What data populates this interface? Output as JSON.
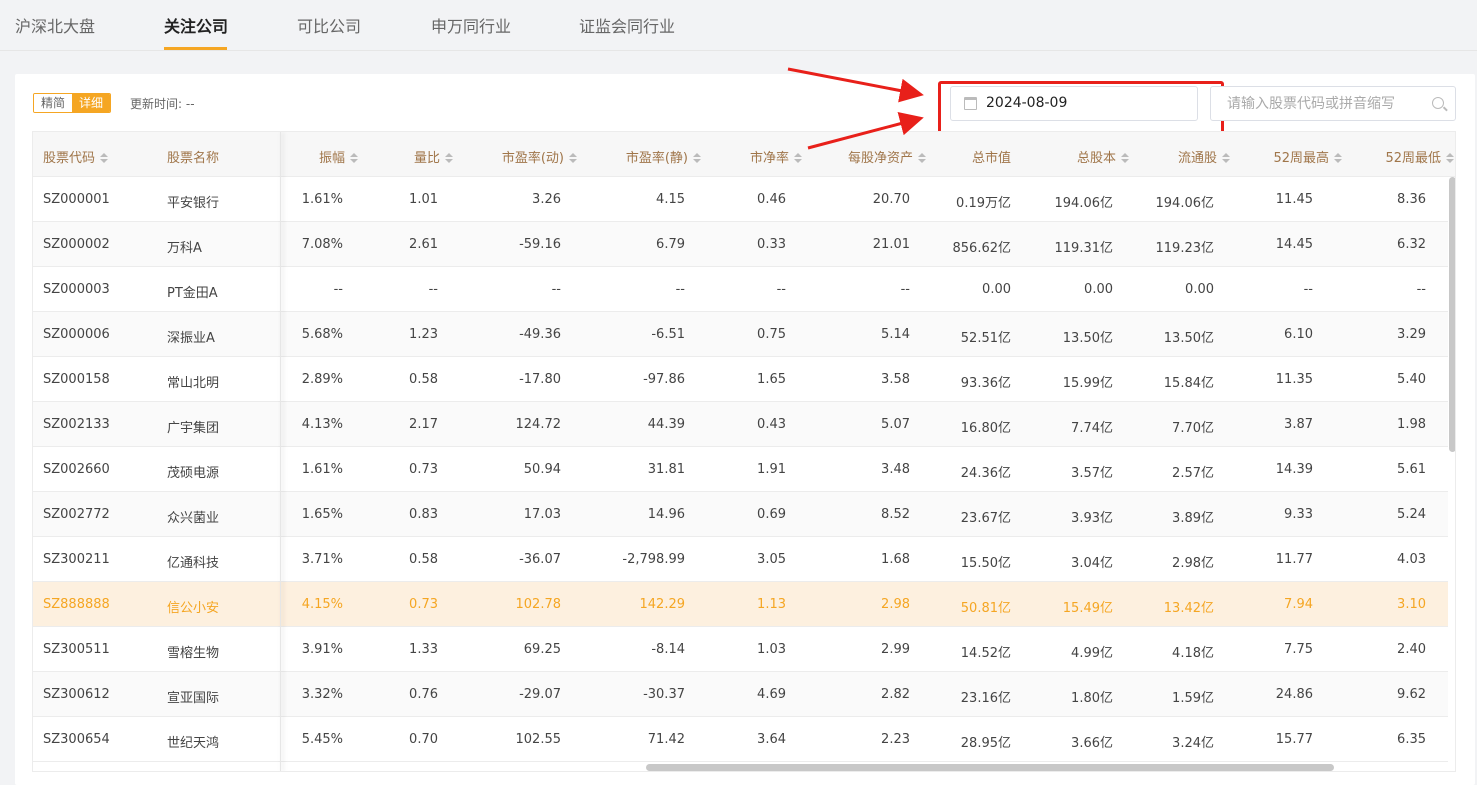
{
  "nav": {
    "tabs": [
      {
        "label": "沪深北大盘"
      },
      {
        "label": "关注公司"
      },
      {
        "label": "可比公司"
      },
      {
        "label": "申万同行业"
      },
      {
        "label": "证监会同行业"
      }
    ],
    "active_index": 1
  },
  "toolbar": {
    "mode_simple": "精简",
    "mode_detail": "详细",
    "update_label": "更新时间: --",
    "date_value": "2024-08-09",
    "search_placeholder": "请输入股票代码或拼音缩写"
  },
  "colors": {
    "accent": "#f5a623",
    "highlight_row": "#fdf0df",
    "annotation": "#e8201a"
  },
  "table": {
    "columns": [
      "股票代码",
      "股票名称",
      "振幅",
      "量比",
      "市盈率(动)",
      "市盈率(静)",
      "市净率",
      "每股净资产",
      "总市值",
      "总股本",
      "流通股",
      "52周最高",
      "52周最低"
    ],
    "rows": [
      [
        "SZ000001",
        "平安银行",
        "1.61%",
        "1.01",
        "3.26",
        "4.15",
        "0.46",
        "20.70",
        "0.19万亿",
        "194.06亿",
        "194.06亿",
        "11.45",
        "8.36"
      ],
      [
        "SZ000002",
        "万科A",
        "7.08%",
        "2.61",
        "-59.16",
        "6.79",
        "0.33",
        "21.01",
        "856.62亿",
        "119.31亿",
        "119.23亿",
        "14.45",
        "6.32"
      ],
      [
        "SZ000003",
        "PT金田A",
        "--",
        "--",
        "--",
        "--",
        "--",
        "--",
        "0.00",
        "0.00",
        "0.00",
        "--",
        "--"
      ],
      [
        "SZ000006",
        "深振业A",
        "5.68%",
        "1.23",
        "-49.36",
        "-6.51",
        "0.75",
        "5.14",
        "52.51亿",
        "13.50亿",
        "13.50亿",
        "6.10",
        "3.29"
      ],
      [
        "SZ000158",
        "常山北明",
        "2.89%",
        "0.58",
        "-17.80",
        "-97.86",
        "1.65",
        "3.58",
        "93.36亿",
        "15.99亿",
        "15.84亿",
        "11.35",
        "5.40"
      ],
      [
        "SZ002133",
        "广宇集团",
        "4.13%",
        "2.17",
        "124.72",
        "44.39",
        "0.43",
        "5.07",
        "16.80亿",
        "7.74亿",
        "7.70亿",
        "3.87",
        "1.98"
      ],
      [
        "SZ002660",
        "茂硕电源",
        "1.61%",
        "0.73",
        "50.94",
        "31.81",
        "1.91",
        "3.48",
        "24.36亿",
        "3.57亿",
        "2.57亿",
        "14.39",
        "5.61"
      ],
      [
        "SZ002772",
        "众兴菌业",
        "1.65%",
        "0.83",
        "17.03",
        "14.96",
        "0.69",
        "8.52",
        "23.67亿",
        "3.93亿",
        "3.89亿",
        "9.33",
        "5.24"
      ],
      [
        "SZ300211",
        "亿通科技",
        "3.71%",
        "0.58",
        "-36.07",
        "-2,798.99",
        "3.05",
        "1.68",
        "15.50亿",
        "3.04亿",
        "2.98亿",
        "11.77",
        "4.03"
      ],
      [
        "SZ888888",
        "信公小安",
        "4.15%",
        "0.73",
        "102.78",
        "142.29",
        "1.13",
        "2.98",
        "50.81亿",
        "15.49亿",
        "13.42亿",
        "7.94",
        "3.10"
      ],
      [
        "SZ300511",
        "雪榕生物",
        "3.91%",
        "1.33",
        "69.25",
        "-8.14",
        "1.03",
        "2.99",
        "14.52亿",
        "4.99亿",
        "4.18亿",
        "7.75",
        "2.40"
      ],
      [
        "SZ300612",
        "宣亚国际",
        "3.32%",
        "0.76",
        "-29.07",
        "-30.37",
        "4.69",
        "2.82",
        "23.16亿",
        "1.80亿",
        "1.59亿",
        "24.86",
        "9.62"
      ],
      [
        "SZ300654",
        "世纪天鸿",
        "5.45%",
        "0.70",
        "102.55",
        "71.42",
        "3.64",
        "2.23",
        "28.95亿",
        "3.66亿",
        "3.24亿",
        "15.77",
        "6.35"
      ]
    ],
    "highlight_row": 9
  }
}
